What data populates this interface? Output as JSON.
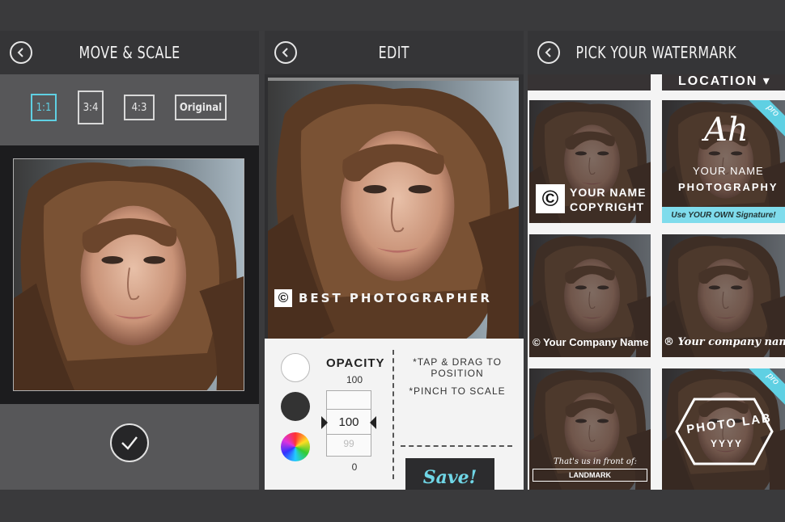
{
  "colors": {
    "accent": "#5fd0e3",
    "dark": "#2c2c2e",
    "panel": "#353537"
  },
  "panel1": {
    "title": "MOVE & SCALE",
    "ratios": [
      "1:1",
      "3:4",
      "4:3",
      "Original"
    ]
  },
  "panel2": {
    "title": "EDIT",
    "watermark_symbol": "©",
    "watermark_text": "BEST PHOTOGRAPHER",
    "opacity": {
      "label": "OPACITY",
      "max": "100",
      "value": "100",
      "next": "99",
      "min": "0"
    },
    "hint1": "*TAP & DRAG TO POSITION",
    "hint2": "*PINCH TO SCALE",
    "save_label": "Save!"
  },
  "panel3": {
    "title": "PICK YOUR WATERMARK",
    "tiles": {
      "location": "LOCATION ▾",
      "copyright_symbol": "©",
      "copyright_line1": "YOUR NAME",
      "copyright_line2": "COPYRIGHT",
      "signature_glyph": "Ah",
      "signature_line1": "YOUR NAME",
      "signature_line2": "PHOTOGRAPHY",
      "signature_banner": "Use YOUR OWN Signature!",
      "pro": "pro",
      "company1": "© Your Company Name",
      "company2": "® Your company name",
      "landmark_top": "That's us in front of:",
      "landmark": "LANDMARK",
      "badge_line1": "PHOTO LAB",
      "badge_line2": "YYYY"
    }
  }
}
